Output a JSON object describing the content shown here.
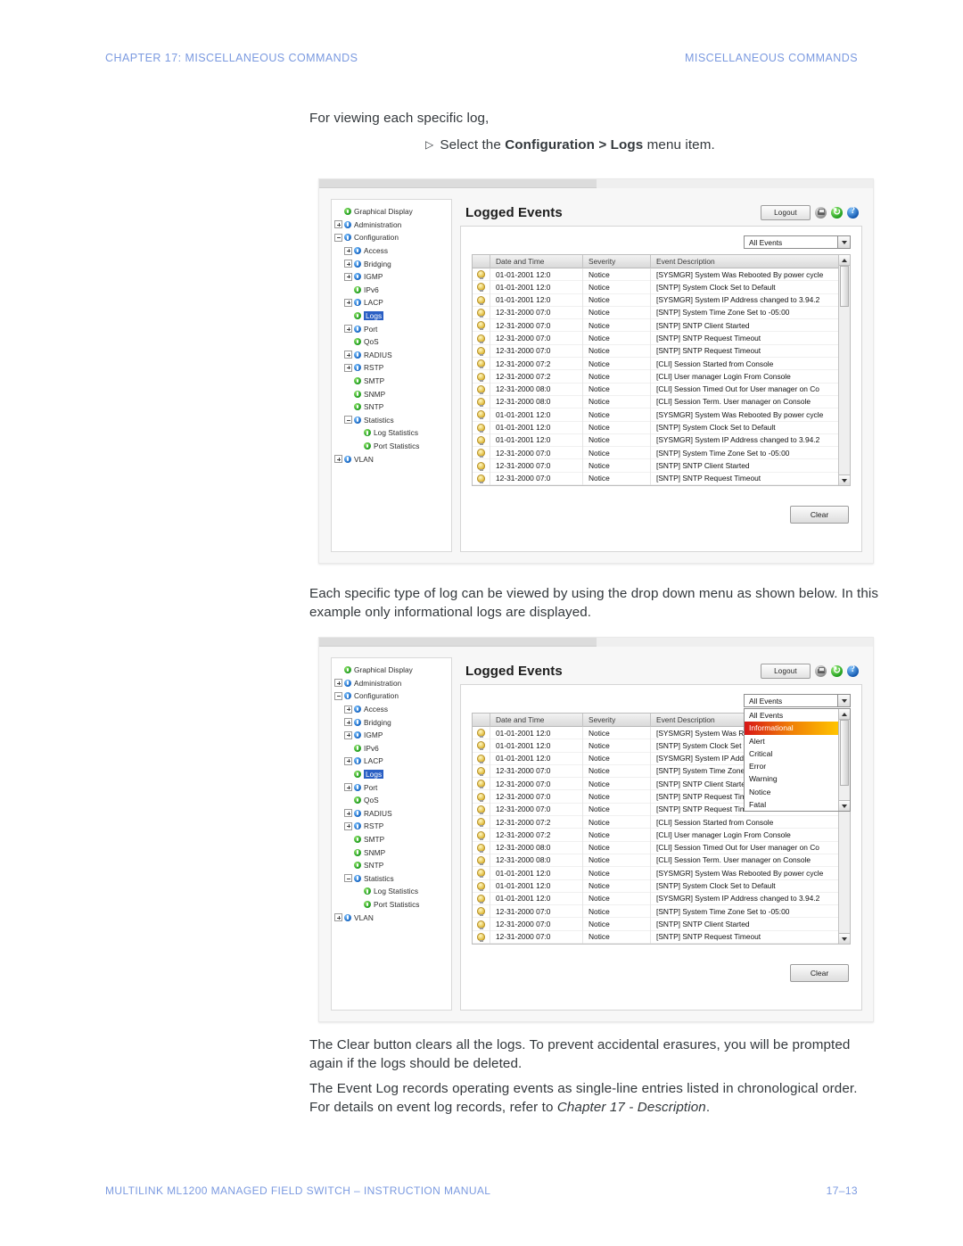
{
  "page": {
    "header_left": "CHAPTER 17: MISCELLANEOUS COMMANDS",
    "header_right": "MISCELLANEOUS COMMANDS",
    "footer_left": "MULTILINK ML1200 MANAGED FIELD SWITCH – INSTRUCTION MANUAL",
    "footer_right": "17–13",
    "accent_color": "#7b9ae0"
  },
  "body": {
    "intro": "For viewing each specific log,",
    "bullet": {
      "marker": "▷",
      "prefix": "Select the ",
      "bold": "Configuration > Logs",
      "suffix": " menu item."
    },
    "para_middle": "Each specific type of log can be viewed by using the drop down menu as shown below. In this example only informational logs are displayed.",
    "para_clear": "The Clear button clears all the logs. To prevent accidental erasures, you will be prompted again if the logs should be deleted.",
    "para_eventlog_prefix": "The Event Log records operating events as single-line entries listed in chronological order. For details on event log records, refer to ",
    "para_eventlog_italic": "Chapter 17 - Description",
    "para_eventlog_suffix": "."
  },
  "tree": {
    "items": [
      {
        "label": "Graphical Display",
        "indent": 0,
        "toggle": "none",
        "dot": "g",
        "selected": false
      },
      {
        "label": "Administration",
        "indent": 0,
        "toggle": "plus",
        "dot": "b",
        "selected": false
      },
      {
        "label": "Configuration",
        "indent": 0,
        "toggle": "minus",
        "dot": "b",
        "selected": false
      },
      {
        "label": "Access",
        "indent": 1,
        "toggle": "plus",
        "dot": "b",
        "selected": false
      },
      {
        "label": "Bridging",
        "indent": 1,
        "toggle": "plus",
        "dot": "b",
        "selected": false
      },
      {
        "label": "IGMP",
        "indent": 1,
        "toggle": "plus",
        "dot": "b",
        "selected": false
      },
      {
        "label": "IPv6",
        "indent": 1,
        "toggle": "none",
        "dot": "g",
        "selected": false
      },
      {
        "label": "LACP",
        "indent": 1,
        "toggle": "plus",
        "dot": "b",
        "selected": false
      },
      {
        "label": "Logs",
        "indent": 1,
        "toggle": "none",
        "dot": "g",
        "selected": true
      },
      {
        "label": "Port",
        "indent": 1,
        "toggle": "plus",
        "dot": "b",
        "selected": false
      },
      {
        "label": "QoS",
        "indent": 1,
        "toggle": "none",
        "dot": "g",
        "selected": false
      },
      {
        "label": "RADIUS",
        "indent": 1,
        "toggle": "plus",
        "dot": "b",
        "selected": false
      },
      {
        "label": "RSTP",
        "indent": 1,
        "toggle": "plus",
        "dot": "b",
        "selected": false
      },
      {
        "label": "SMTP",
        "indent": 1,
        "toggle": "none",
        "dot": "g",
        "selected": false
      },
      {
        "label": "SNMP",
        "indent": 1,
        "toggle": "none",
        "dot": "g",
        "selected": false
      },
      {
        "label": "SNTP",
        "indent": 1,
        "toggle": "none",
        "dot": "g",
        "selected": false
      },
      {
        "label": "Statistics",
        "indent": 1,
        "toggle": "minus",
        "dot": "b",
        "selected": false
      },
      {
        "label": "Log Statistics",
        "indent": 2,
        "toggle": "none",
        "dot": "g",
        "selected": false
      },
      {
        "label": "Port Statistics",
        "indent": 2,
        "toggle": "none",
        "dot": "g",
        "selected": false
      },
      {
        "label": "VLAN",
        "indent": 0,
        "toggle": "plus",
        "dot": "b",
        "selected": false
      }
    ]
  },
  "panel": {
    "title": "Logged Events",
    "logout_label": "Logout",
    "clear_label": "Clear",
    "icons": [
      "printer-icon",
      "refresh-icon",
      "help-icon"
    ]
  },
  "filter": {
    "selected": "All Events",
    "options": [
      "All Events",
      "Informational",
      "Alert",
      "Critical",
      "Error",
      "Warning",
      "Notice",
      "Fatal"
    ],
    "highlighted": "Informational",
    "highlight_color": "#ef7d07"
  },
  "table": {
    "columns": [
      "",
      "Date and Time",
      "Severity",
      "Event Description"
    ],
    "rows": [
      {
        "date": "01-01-2001 12:0",
        "severity": "Notice",
        "desc": "[SYSMGR] System Was Rebooted By power cycle"
      },
      {
        "date": "01-01-2001 12:0",
        "severity": "Notice",
        "desc": "[SNTP] System Clock Set to Default"
      },
      {
        "date": "01-01-2001 12:0",
        "severity": "Notice",
        "desc": "[SYSMGR] System IP Address changed to 3.94.2"
      },
      {
        "date": "12-31-2000 07:0",
        "severity": "Notice",
        "desc": "[SNTP] System Time Zone Set to -05:00"
      },
      {
        "date": "12-31-2000 07:0",
        "severity": "Notice",
        "desc": "[SNTP] SNTP Client Started"
      },
      {
        "date": "12-31-2000 07:0",
        "severity": "Notice",
        "desc": "[SNTP] SNTP Request Timeout"
      },
      {
        "date": "12-31-2000 07:0",
        "severity": "Notice",
        "desc": "[SNTP] SNTP Request Timeout"
      },
      {
        "date": "12-31-2000 07:2",
        "severity": "Notice",
        "desc": "[CLI] Session Started from Console"
      },
      {
        "date": "12-31-2000 07:2",
        "severity": "Notice",
        "desc": "[CLI] User manager Login From Console"
      },
      {
        "date": "12-31-2000 08:0",
        "severity": "Notice",
        "desc": "[CLI] Session Timed Out for User manager on Co"
      },
      {
        "date": "12-31-2000 08:0",
        "severity": "Notice",
        "desc": "[CLI] Session Term. User manager on Console"
      },
      {
        "date": "01-01-2001 12:0",
        "severity": "Notice",
        "desc": "[SYSMGR] System Was Rebooted By power cycle"
      },
      {
        "date": "01-01-2001 12:0",
        "severity": "Notice",
        "desc": "[SNTP] System Clock Set to Default"
      },
      {
        "date": "01-01-2001 12:0",
        "severity": "Notice",
        "desc": "[SYSMGR] System IP Address changed to 3.94.2"
      },
      {
        "date": "12-31-2000 07:0",
        "severity": "Notice",
        "desc": "[SNTP] System Time Zone Set to -05:00"
      },
      {
        "date": "12-31-2000 07:0",
        "severity": "Notice",
        "desc": "[SNTP] SNTP Client Started"
      },
      {
        "date": "12-31-2000 07:0",
        "severity": "Notice",
        "desc": "[SNTP] SNTP Request Timeout"
      }
    ]
  }
}
